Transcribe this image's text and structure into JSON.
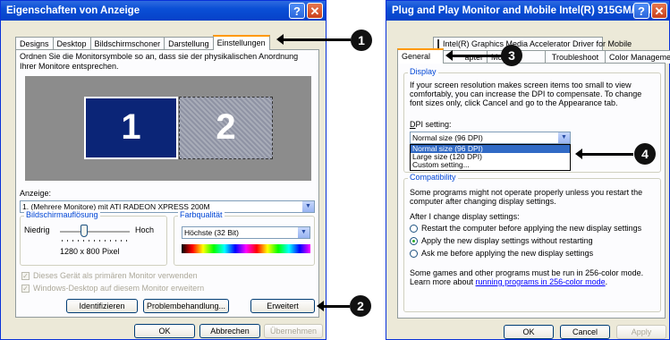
{
  "left_window": {
    "title": "Eigenschaften von Anzeige",
    "tabs": [
      "Designs",
      "Desktop",
      "Bildschirmschoner",
      "Darstellung",
      "Einstellungen"
    ],
    "active_tab": "Einstellungen",
    "instruction": "Ordnen Sie die Monitorsymbole so an, dass sie der physikalischen Anordnung Ihrer Monitore entsprechen.",
    "monitor_1": "1",
    "monitor_2": "2",
    "display_label": "Anzeige:",
    "display_value": "1. (Mehrere Monitore) mit ATI RADEON XPRESS 200M",
    "resolution_group": "Bildschirmauflösung",
    "res_low": "Niedrig",
    "res_high": "Hoch",
    "res_value": "1280 x 800 Pixel",
    "slider_level": 0.35,
    "color_group": "Farbqualität",
    "color_value": "Höchste (32 Bit)",
    "check_primary": "Dieses Gerät als primären Monitor verwenden",
    "check_extend": "Windows-Desktop auf diesem Monitor erweitern",
    "btn_identify": "Identifizieren",
    "btn_troubleshoot": "Problembehandlung...",
    "btn_advanced": "Erweitert",
    "btn_ok": "OK",
    "btn_cancel": "Abbrechen",
    "btn_apply": "Übernehmen"
  },
  "right_window": {
    "title": "Plug and Play Monitor and Mobile Intel(R) 915GM/GM...",
    "tab_row_top": "Intel(R) Graphics Media Accelerator Driver for Mobile",
    "tabs": [
      "General",
      "Adapter",
      "Monitor",
      "Troubleshoot",
      "Color Management"
    ],
    "tab_general": "General",
    "tab_adapter_end": "apter",
    "tab_monitor_end": "Mo",
    "tab_troubleshoot": "Troubleshoot",
    "tab_color": "Color Management",
    "display_group": "Display",
    "display_text": "If your screen resolution makes screen items too small to view comfortably, you can increase the DPI to compensate.  To change font sizes only, click Cancel and go to the Appearance tab.",
    "dpi_label_prefix": "D",
    "dpi_label_rest": "PI setting:",
    "dpi_value": "Normal size (96 DPI)",
    "dpi_options": [
      "Normal size (96 DPI)",
      "Large size (120 DPI)",
      "Custom setting..."
    ],
    "compat_group": "Compatibility",
    "compat_text": "Some programs might not operate properly unless you restart the computer after changing display settings.",
    "after_change": "After I change display settings:",
    "radio_restart": "Restart the computer before applying the new display settings",
    "radio_apply": "Apply the new display settings without restarting",
    "radio_ask": "Ask me before applying the new display settings",
    "colormode_text": "Some games and other programs must be run in 256-color mode.",
    "learn_prefix": "Learn more about ",
    "learn_link": "running programs in 256-color mode",
    "learn_suffix": ".",
    "btn_ok": "OK",
    "btn_cancel": "Cancel",
    "btn_apply": "Apply"
  },
  "callouts": [
    "1",
    "2",
    "3",
    "4"
  ],
  "colors": {
    "titlebar": "#0a4fd6",
    "desktop_preview": "#8c8c8c",
    "monitor_1": "#0b2577",
    "link": "#0000ff"
  }
}
